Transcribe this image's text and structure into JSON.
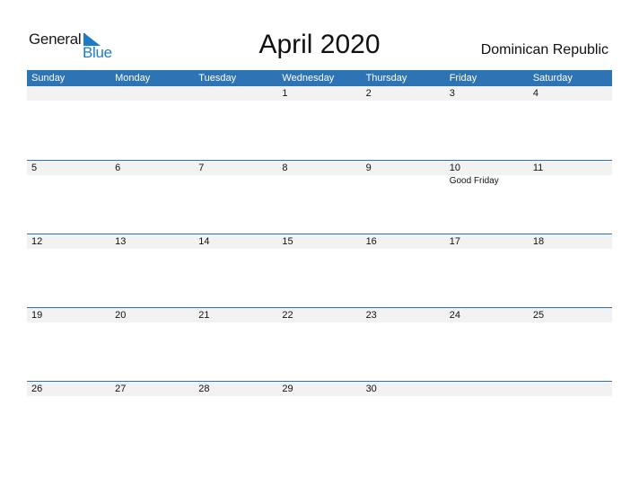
{
  "logo": {
    "general": "General",
    "blue": "Blue"
  },
  "title": "April 2020",
  "country": "Dominican Republic",
  "colors": {
    "accent": "#2e74b5",
    "logo_blue": "#1e7bc8",
    "row_bg": "#f2f2f2"
  },
  "weekdays": [
    "Sunday",
    "Monday",
    "Tuesday",
    "Wednesday",
    "Thursday",
    "Friday",
    "Saturday"
  ],
  "weeks": [
    {
      "days": [
        "",
        "",
        "",
        "1",
        "2",
        "3",
        "4"
      ],
      "events": [
        "",
        "",
        "",
        "",
        "",
        "",
        ""
      ]
    },
    {
      "days": [
        "5",
        "6",
        "7",
        "8",
        "9",
        "10",
        "11"
      ],
      "events": [
        "",
        "",
        "",
        "",
        "",
        "Good Friday",
        ""
      ]
    },
    {
      "days": [
        "12",
        "13",
        "14",
        "15",
        "16",
        "17",
        "18"
      ],
      "events": [
        "",
        "",
        "",
        "",
        "",
        "",
        ""
      ]
    },
    {
      "days": [
        "19",
        "20",
        "21",
        "22",
        "23",
        "24",
        "25"
      ],
      "events": [
        "",
        "",
        "",
        "",
        "",
        "",
        ""
      ]
    },
    {
      "days": [
        "26",
        "27",
        "28",
        "29",
        "30",
        "",
        ""
      ],
      "events": [
        "",
        "",
        "",
        "",
        "",
        "",
        ""
      ]
    }
  ]
}
